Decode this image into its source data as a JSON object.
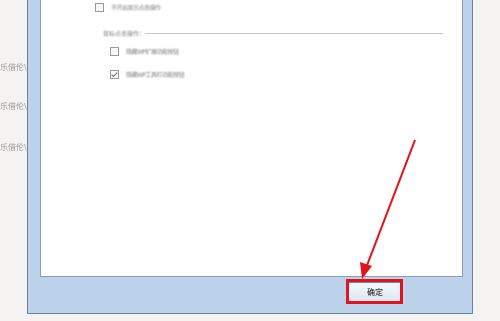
{
  "background_labels": [
    "乐借伦\\",
    "乐借伦\\",
    "乐借伦\\"
  ],
  "options": {
    "top_option": {
      "label": "不开启显示点击操作",
      "checked": false
    },
    "group_heading": "鼠标点击操作：",
    "group_options": [
      {
        "label": "隐藏WP扩展功能按钮",
        "checked": false
      },
      {
        "label": "隐藏WP工具栏功能按钮",
        "checked": true
      }
    ]
  },
  "ok_button_label": "确定",
  "colors": {
    "highlight": "#e0141a",
    "arrow": "#e0141a",
    "frame": "#bcd2ea"
  }
}
